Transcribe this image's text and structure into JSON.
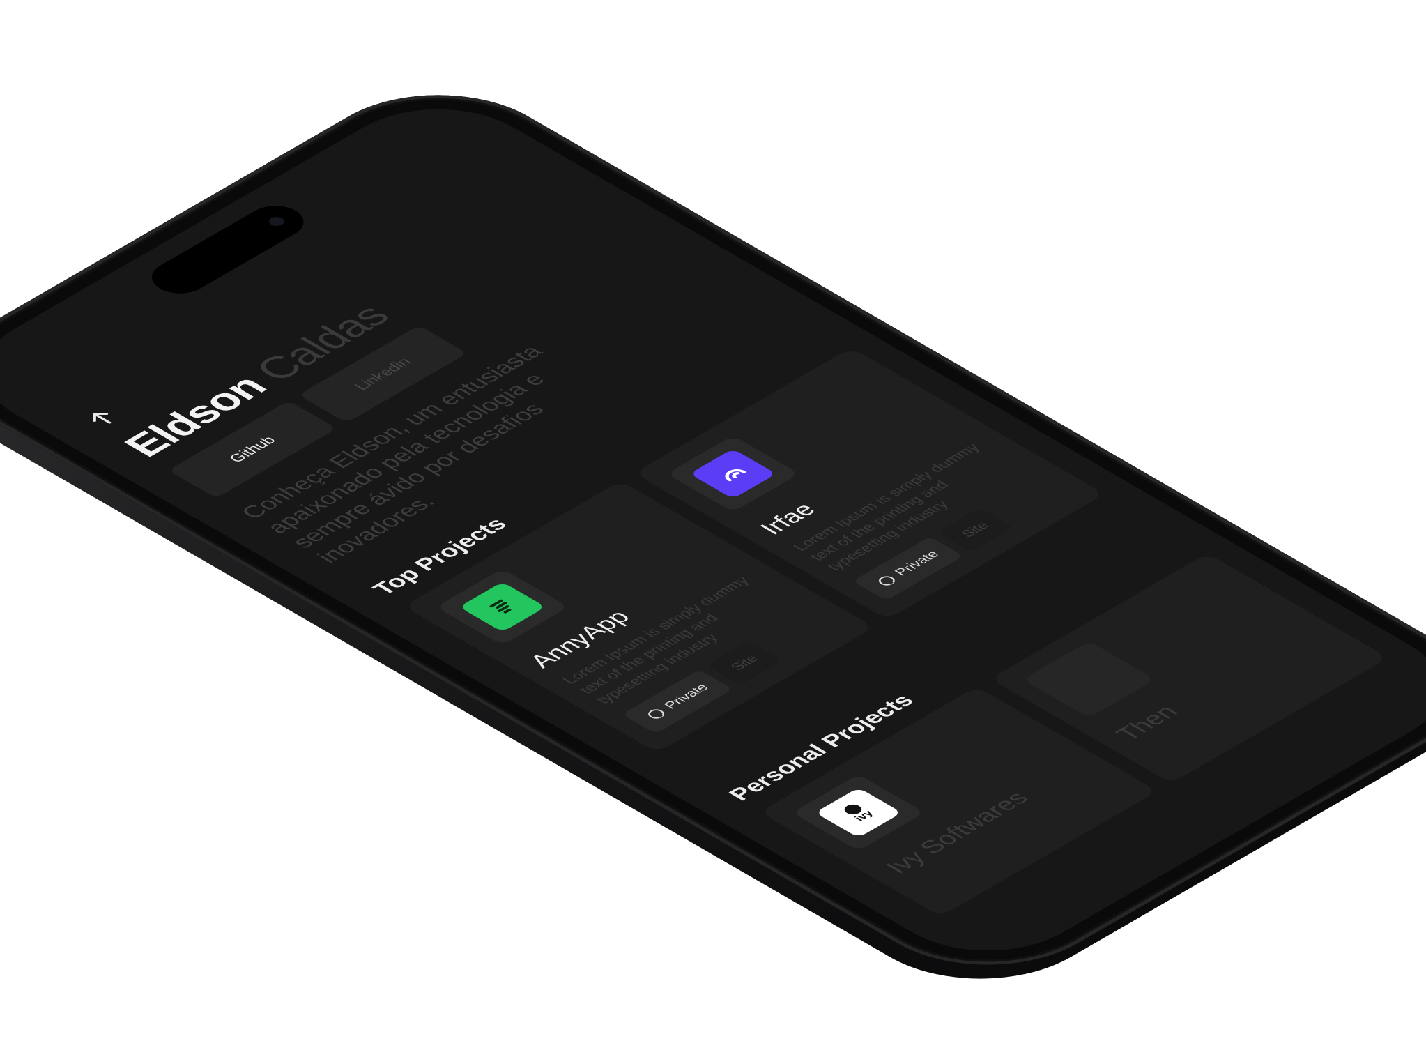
{
  "profile": {
    "first_name": "Eldson",
    "last_name": "Caldas",
    "links": [
      {
        "label": "Github"
      },
      {
        "label": "Linkedin"
      }
    ],
    "bio": "Conheça Eldson, um entusiasta apaixonado pela tecnologia e sempre ávido por desafios inovadores."
  },
  "top_projects": {
    "title": "Top Projects",
    "items": [
      {
        "name": "AnnyApp",
        "description": "Lorem Ipsum is simply dummy text of the printing and typesetting industry",
        "private_label": "Private",
        "site_label": "Site",
        "logo_color": "#22c55e",
        "logo_icon": "annyapp-logo-icon"
      },
      {
        "name": "Irfae",
        "description": "Lorem Ipsum is simply dummy text of the printing and typesetting industry",
        "private_label": "Private",
        "site_label": "Site",
        "logo_color": "#5b3df5",
        "logo_icon": "irfae-logo-icon"
      }
    ]
  },
  "personal_projects": {
    "title": "Personal Projects",
    "items": [
      {
        "name": "Ivy Softwares",
        "logo_icon": "ivy-logo-icon",
        "logo_text": "ivy",
        "logo_color": "#ffffff"
      },
      {
        "name": "Then",
        "logo_icon": "then-logo-icon"
      }
    ]
  },
  "colors": {
    "screen_bg": "#171717",
    "card_bg": "#1f1f1f",
    "frame": "#0a0a0a"
  }
}
